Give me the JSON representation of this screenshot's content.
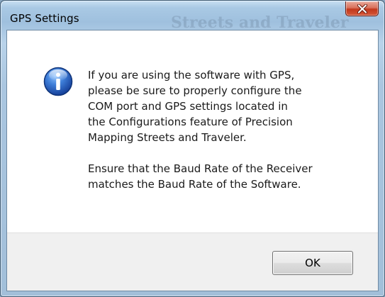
{
  "window": {
    "title": "GPS Settings",
    "background_ghost_text": "Streets and Traveler"
  },
  "dialog": {
    "icon": "info-icon",
    "message_paragraph_1": "If you are using the software with GPS,\nplease be sure to properly configure the\nCOM port and GPS settings located in\nthe Configurations feature of Precision\nMapping Streets and Traveler.",
    "message_paragraph_2": "Ensure that the Baud Rate of the Receiver\nmatches the Baud Rate of the Software."
  },
  "buttons": {
    "ok_label": "OK",
    "close_icon": "close-icon"
  },
  "colors": {
    "close_button": "#c2381c",
    "info_icon": "#2a5fb8",
    "footer": "#f0f0f0"
  }
}
